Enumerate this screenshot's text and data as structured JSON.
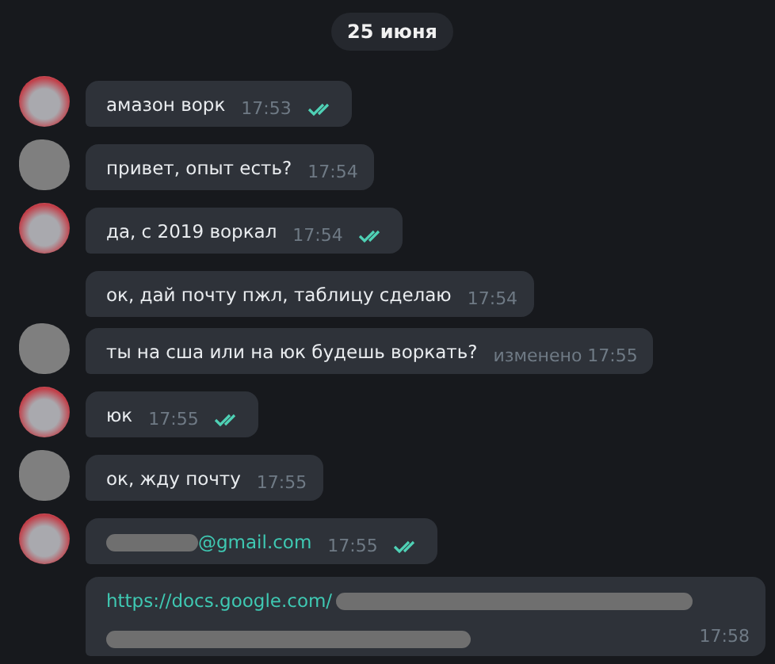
{
  "date_label": "25 июня",
  "messages": [
    {
      "avatar": {
        "kind": "photo"
      },
      "kind": "text",
      "text": "амазон ворк",
      "time": "17:53",
      "read": true
    },
    {
      "avatar": {
        "kind": "blurred"
      },
      "kind": "text",
      "text": "привет, опыт есть?",
      "time": "17:54",
      "read": false
    },
    {
      "avatar": {
        "kind": "photo"
      },
      "kind": "text",
      "text": "да, с 2019 воркал",
      "time": "17:54",
      "read": true
    },
    {
      "kind": "text",
      "text": "ок, дай почту пжл, таблицу сделаю",
      "time": "17:54",
      "read": false
    },
    {
      "avatar": {
        "kind": "blurred"
      },
      "kind": "text",
      "text": "ты на сша или на юк будешь воркать?",
      "edited": "изменено",
      "time": "17:55",
      "read": false
    },
    {
      "avatar": {
        "kind": "photo"
      },
      "kind": "text",
      "text": "юк",
      "time": "17:55",
      "read": true
    },
    {
      "avatar": {
        "kind": "blurred"
      },
      "kind": "text",
      "text": "ок, жду почту",
      "time": "17:55",
      "read": false
    },
    {
      "avatar": {
        "kind": "photo"
      },
      "kind": "email",
      "text": "@gmail.com",
      "time": "17:55",
      "read": true
    },
    {
      "kind": "link",
      "text": "https://docs.google.com/",
      "time": "17:58",
      "read": false
    }
  ]
}
